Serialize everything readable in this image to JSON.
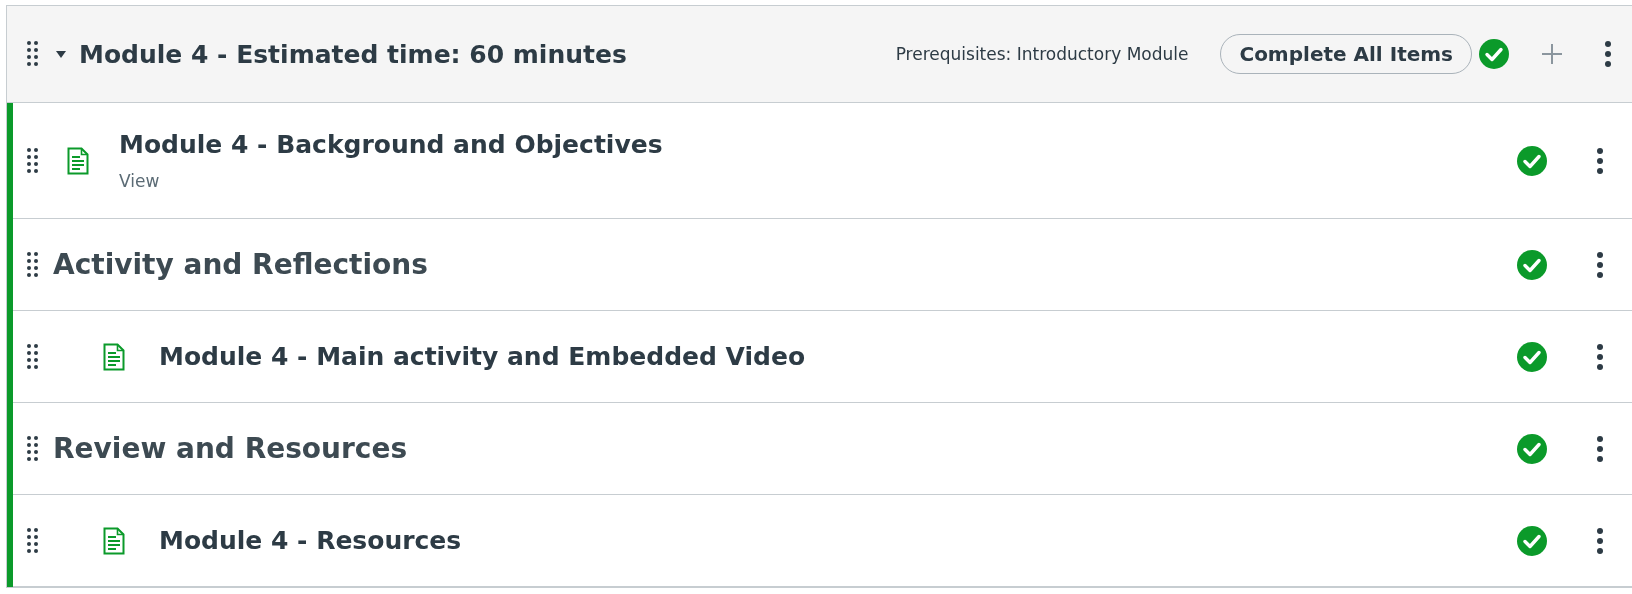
{
  "module": {
    "title": "Module 4 - Estimated time: 60 minutes",
    "expanded": true,
    "prerequisites": "Prerequisites: Introductory Module",
    "requirement": "Complete All Items",
    "completed": true
  },
  "items": [
    {
      "kind": "page",
      "title": "Module 4 - Background and Objectives",
      "subtitle": "View",
      "completed": true
    },
    {
      "kind": "header",
      "title": "Activity and Reflections",
      "completed": true,
      "children": [
        {
          "kind": "page",
          "title": "Module 4 - Main activity and Embedded Video",
          "completed": true
        }
      ]
    },
    {
      "kind": "header",
      "title": "Review and Resources",
      "completed": true,
      "children": [
        {
          "kind": "page",
          "title": "Module 4 - Resources",
          "completed": true
        }
      ]
    }
  ]
}
